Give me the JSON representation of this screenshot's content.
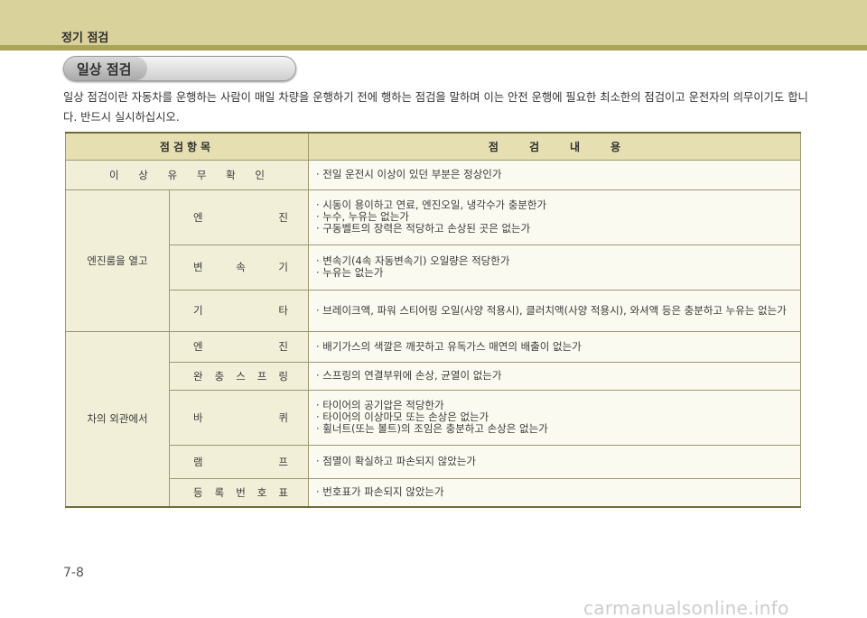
{
  "header": {
    "section_title": "정기 점검"
  },
  "pill": {
    "label": "일상 점검"
  },
  "intro": {
    "text": "일상 점검이란 자동차를 운행하는 사람이 매일 차량을 운행하기 전에 행하는 점검을 말하며 이는 안전 운행에 필요한 최소한의 점검이고 운전자의 의무이기도 합니다. 반드시 실시하십시오."
  },
  "table": {
    "header_item": "점검항목",
    "header_content": "점검내용",
    "row1": {
      "label": [
        "이",
        "상",
        "유",
        "무",
        "확",
        "인"
      ],
      "lines": [
        "· 전일 운전시 이상이 있던 부분은 정상인가"
      ]
    },
    "group1": {
      "label": "엔진룸을 열고",
      "engine": {
        "label": [
          "엔",
          "진"
        ],
        "lines": [
          "· 시동이 용이하고 연료, 엔진오일, 냉각수가 충분한가",
          "· 누수, 누유는 없는가",
          "· 구동벨트의 장력은 적당하고 손상된 곳은 없는가"
        ]
      },
      "transmission": {
        "label": [
          "변",
          "속",
          "기"
        ],
        "lines": [
          "· 변속기(4속 자동변속기) 오일량은 적당한가",
          "· 누유는 없는가"
        ]
      },
      "other": {
        "label": [
          "기",
          "타"
        ],
        "lines": [
          "· 브레이크액, 파워 스티어링 오일(사양 적용시), 클러치액(사양 적용시), 와셔액 등은 충분하고 누유는 없는가"
        ]
      }
    },
    "group2": {
      "label": "차의 외관에서",
      "engine": {
        "label": [
          "엔",
          "진"
        ],
        "lines": [
          "· 배기가스의 색깔은 깨끗하고 유독가스 매연의 배출이 없는가"
        ]
      },
      "spring": {
        "label": [
          "완",
          "충",
          "스",
          "프",
          "링"
        ],
        "lines": [
          "· 스프링의 연결부위에 손상, 균열이 없는가"
        ]
      },
      "wheel": {
        "label": [
          "바",
          "퀴"
        ],
        "lines": [
          "· 타이어의 공기압은 적당한가",
          "· 타이어의 이상마모 또는 손상은 없는가",
          "· 휠너트(또는 볼트)의 조임은 충분하고 손상은 없는가"
        ]
      },
      "lamp": {
        "label": [
          "램",
          "프"
        ],
        "lines": [
          "· 점멸이 확실하고 파손되지 않았는가"
        ]
      },
      "plate": {
        "label": [
          "등",
          "록",
          "번",
          "호",
          "표"
        ],
        "lines": [
          "· 번호표가 파손되지 않았는가"
        ]
      }
    }
  },
  "page_number": "7-8",
  "watermark": "carmanualsonline.info",
  "colors": {
    "header_band": "#d9d29a",
    "header_rule": "#a9a458",
    "table_header": "#e6dfb1",
    "table_label_cell": "#f2efd9"
  }
}
